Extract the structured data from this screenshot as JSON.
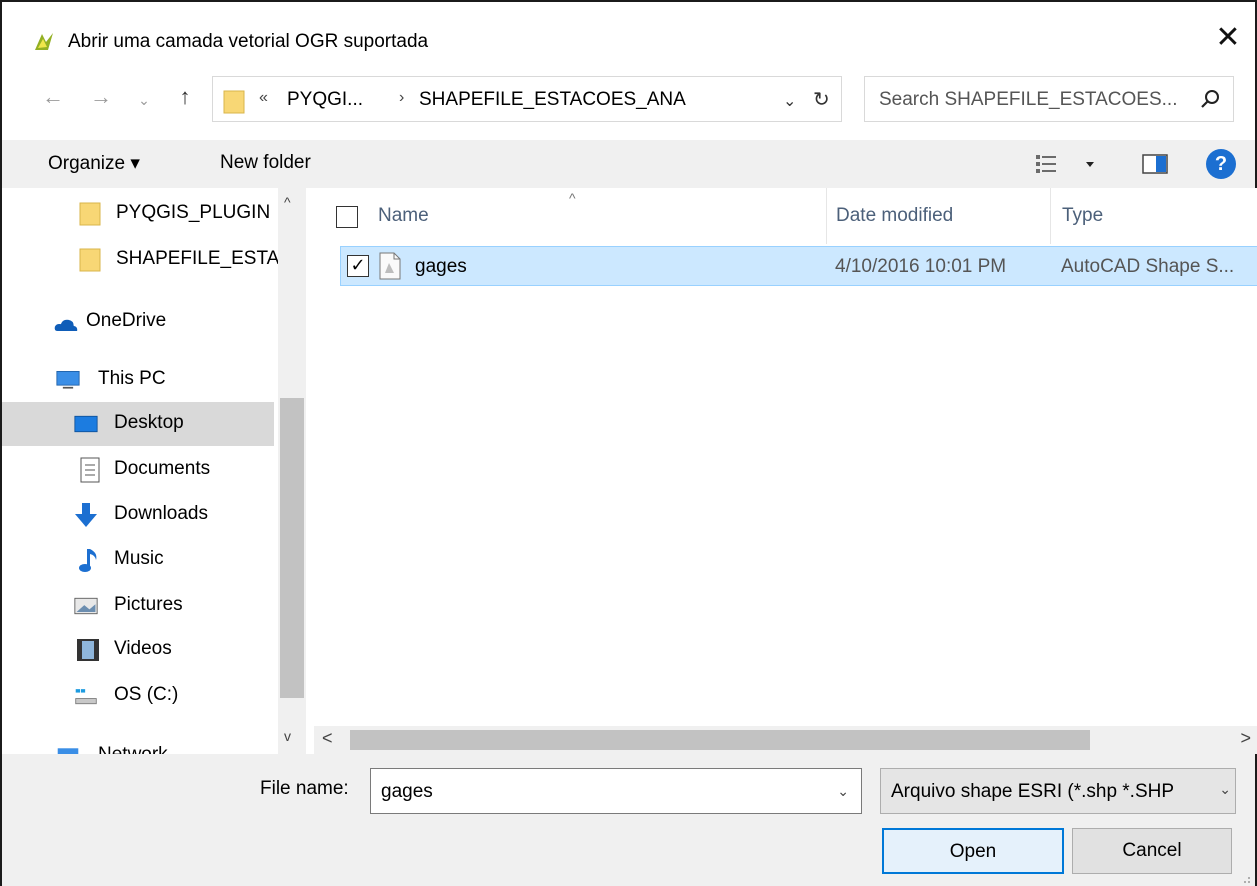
{
  "window": {
    "title": "Abrir uma camada vetorial OGR suportada",
    "close_glyph": "✕"
  },
  "address_bar": {
    "back_glyph": "←",
    "forward_glyph": "→",
    "recent_glyph": "⌄",
    "up_glyph": "↑",
    "overflow_glyph": "«",
    "path_parent": "PYQGI...",
    "separator_glyph": "›",
    "path_current": "SHAPEFILE_ESTACOES_ANA",
    "dropdown_glyph": "⌄",
    "refresh_glyph": "↻"
  },
  "search": {
    "placeholder": "Search SHAPEFILE_ESTACOES...",
    "icon": "search-icon"
  },
  "toolbar": {
    "organize_label": "Organize ▾",
    "new_folder_label": "New folder",
    "help_label": "?"
  },
  "nav_pane": {
    "items": [
      {
        "label": "PYQGIS_PLUGIN",
        "icon": "folder-icon"
      },
      {
        "label": "SHAPEFILE_ESTA",
        "icon": "folder-icon"
      },
      {
        "label": "OneDrive",
        "icon": "onedrive-icon"
      },
      {
        "label": "This PC",
        "icon": "computer-icon"
      },
      {
        "label": "Desktop",
        "icon": "desktop-icon",
        "selected": true
      },
      {
        "label": "Documents",
        "icon": "documents-icon"
      },
      {
        "label": "Downloads",
        "icon": "downloads-icon"
      },
      {
        "label": "Music",
        "icon": "music-icon"
      },
      {
        "label": "Pictures",
        "icon": "pictures-icon"
      },
      {
        "label": "Videos",
        "icon": "videos-icon"
      },
      {
        "label": "OS (C:)",
        "icon": "drive-icon"
      },
      {
        "label": "Network",
        "icon": "network-icon"
      }
    ],
    "scroll_up_glyph": "^",
    "scroll_down_glyph": "v"
  },
  "file_list": {
    "columns": [
      "Name",
      "Date modified",
      "Type"
    ],
    "sort_glyph": "^",
    "rows": [
      {
        "name": "gages",
        "date_modified": "4/10/2016 10:01 PM",
        "type": "AutoCAD Shape S...",
        "checked": true,
        "selected": true
      }
    ],
    "check_glyph": "✓"
  },
  "hscroll": {
    "left_glyph": "<",
    "right_glyph": ">"
  },
  "bottom": {
    "file_name_label": "File name:",
    "file_name_value": "gages",
    "file_name_drop_glyph": "⌄",
    "filter_value": "Arquivo shape ESRI (*.shp *.SHP",
    "filter_drop_glyph": "⌄",
    "open_label": "Open",
    "cancel_label": "Cancel"
  },
  "colors": {
    "selection_bg": "#cce8ff",
    "selection_border": "#99d1ff",
    "accent": "#0078d7",
    "help_blue": "#1c6fd1",
    "folder_yellow": "#f8d775"
  }
}
